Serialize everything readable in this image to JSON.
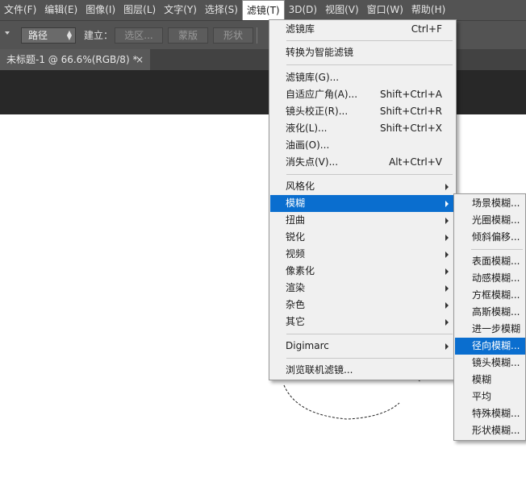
{
  "menubar": {
    "items": [
      "文件(F)",
      "编辑(E)",
      "图像(I)",
      "图层(L)",
      "文字(Y)",
      "选择(S)",
      "滤镜(T)",
      "3D(D)",
      "视图(V)",
      "窗口(W)",
      "帮助(H)"
    ],
    "active_index": 6
  },
  "options": {
    "mode_value": "路径",
    "make_label": "建立：",
    "btn_selection": "选区...",
    "btn_mask": "蒙版",
    "btn_shape": "形状"
  },
  "document": {
    "tab_title": "未标题-1 @ 66.6%(RGB/8) *",
    "close_glyph": "×"
  },
  "filter_menu": {
    "items": [
      {
        "label": "滤镜库",
        "shortcut": "Ctrl+F"
      },
      {
        "label": "转换为智能滤镜"
      },
      {
        "label": "滤镜库(G)..."
      },
      {
        "label": "自适应广角(A)...",
        "shortcut": "Shift+Ctrl+A"
      },
      {
        "label": "镜头校正(R)...",
        "shortcut": "Shift+Ctrl+R"
      },
      {
        "label": "液化(L)...",
        "shortcut": "Shift+Ctrl+X"
      },
      {
        "label": "油画(O)..."
      },
      {
        "label": "消失点(V)...",
        "shortcut": "Alt+Ctrl+V"
      },
      {
        "label": "风格化"
      },
      {
        "label": "模糊"
      },
      {
        "label": "扭曲"
      },
      {
        "label": "锐化"
      },
      {
        "label": "视频"
      },
      {
        "label": "像素化"
      },
      {
        "label": "渲染"
      },
      {
        "label": "杂色"
      },
      {
        "label": "其它"
      },
      {
        "label": "Digimarc"
      },
      {
        "label": "浏览联机滤镜..."
      }
    ],
    "highlighted_index": 9
  },
  "blur_submenu": {
    "items": [
      "场景模糊...",
      "光圈模糊...",
      "倾斜偏移...",
      "表面模糊...",
      "动感模糊...",
      "方框模糊...",
      "高斯模糊...",
      "进一步模糊",
      "径向模糊...",
      "镜头模糊...",
      "模糊",
      "平均",
      "特殊模糊...",
      "形状模糊..."
    ],
    "highlighted_index": 8
  },
  "colors": {
    "menubar_bg": "#535353",
    "highlight": "#0a6ecf",
    "menu_bg": "#f0f0f0",
    "pasteboard": "#282828"
  }
}
